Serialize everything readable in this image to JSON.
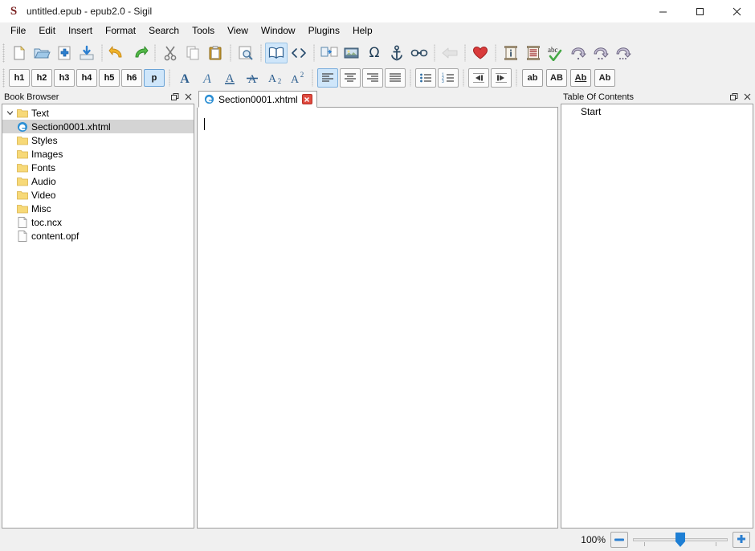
{
  "window": {
    "title": "untitled.epub - epub2.0 - Sigil",
    "logo": "sigil-logo",
    "minimize_label": "–",
    "maximize_label": "☐",
    "close_label": "×"
  },
  "menubar": {
    "items": [
      {
        "label": "File",
        "name": "menu-file"
      },
      {
        "label": "Edit",
        "name": "menu-edit"
      },
      {
        "label": "Insert",
        "name": "menu-insert"
      },
      {
        "label": "Format",
        "name": "menu-format"
      },
      {
        "label": "Search",
        "name": "menu-search"
      },
      {
        "label": "Tools",
        "name": "menu-tools"
      },
      {
        "label": "View",
        "name": "menu-view"
      },
      {
        "label": "Window",
        "name": "menu-window"
      },
      {
        "label": "Plugins",
        "name": "menu-plugins"
      },
      {
        "label": "Help",
        "name": "menu-help"
      }
    ]
  },
  "toolbar_main": {
    "items": [
      {
        "name": "new-file-icon",
        "tooltip": "New"
      },
      {
        "name": "open-file-icon",
        "tooltip": "Open"
      },
      {
        "name": "add-file-icon",
        "tooltip": "Add Existing Files"
      },
      {
        "name": "save-icon",
        "tooltip": "Save"
      },
      {
        "name": "undo-icon",
        "tooltip": "Undo"
      },
      {
        "name": "redo-icon",
        "tooltip": "Redo"
      },
      {
        "name": "cut-icon",
        "tooltip": "Cut"
      },
      {
        "name": "copy-icon",
        "tooltip": "Copy"
      },
      {
        "name": "paste-icon",
        "tooltip": "Paste"
      },
      {
        "name": "find-replace-icon",
        "tooltip": "Find & Replace"
      },
      {
        "name": "book-view-icon",
        "tooltip": "Book View"
      },
      {
        "name": "code-view-icon",
        "tooltip": "Code View"
      },
      {
        "name": "split-at-cursor-icon",
        "tooltip": "Split At Cursor"
      },
      {
        "name": "insert-image-icon",
        "tooltip": "Insert File"
      },
      {
        "name": "special-character-icon",
        "tooltip": "Insert Special Character"
      },
      {
        "name": "insert-id-icon",
        "tooltip": "Insert ID"
      },
      {
        "name": "insert-link-icon",
        "tooltip": "Insert Link"
      },
      {
        "name": "back-icon",
        "tooltip": "Back"
      },
      {
        "name": "heart-icon",
        "tooltip": "Donate"
      },
      {
        "name": "metadata-editor-icon",
        "tooltip": "Metadata Editor"
      },
      {
        "name": "toc-editor-icon",
        "tooltip": "Table Of Contents Editor"
      },
      {
        "name": "spellcheck-icon",
        "tooltip": "Spellcheck"
      },
      {
        "name": "previous-misspelling-icon",
        "tooltip": "Previous Misspelling"
      },
      {
        "name": "next-misspelling-icon",
        "tooltip": "Next Misspelling"
      },
      {
        "name": "add-misspelling-icon",
        "tooltip": "Add Misspelled Word"
      }
    ],
    "book_view_active": true,
    "special_character_glyph": "Ω"
  },
  "toolbar_format": {
    "headings": [
      {
        "label": "h1",
        "active": false
      },
      {
        "label": "h2",
        "active": false
      },
      {
        "label": "h3",
        "active": false
      },
      {
        "label": "h4",
        "active": false
      },
      {
        "label": "h5",
        "active": false
      },
      {
        "label": "h6",
        "active": false
      },
      {
        "label": "p",
        "active": true
      }
    ],
    "styles": [
      {
        "label": "A",
        "name": "bold-icon"
      },
      {
        "label": "A",
        "name": "italic-icon"
      },
      {
        "label": "A",
        "name": "underline-icon"
      },
      {
        "label": "A",
        "name": "strikethrough-icon"
      },
      {
        "label": "A",
        "sub": "2",
        "name": "subscript-icon"
      },
      {
        "label": "A",
        "sup": "2",
        "name": "superscript-icon"
      }
    ],
    "alignment": [
      {
        "name": "align-left-icon",
        "active": true
      },
      {
        "name": "align-center-icon",
        "active": false
      },
      {
        "name": "align-right-icon",
        "active": false
      },
      {
        "name": "align-justify-icon",
        "active": false
      }
    ],
    "lists": [
      {
        "name": "bullet-list-icon"
      },
      {
        "name": "numbered-list-icon"
      }
    ],
    "indent": [
      {
        "name": "decrease-indent-icon"
      },
      {
        "name": "increase-indent-icon"
      }
    ],
    "case_buttons": [
      {
        "label": "ab",
        "name": "lowercase-button"
      },
      {
        "label": "AB",
        "name": "uppercase-button"
      },
      {
        "label": "Ab",
        "name": "titlecase-button"
      },
      {
        "label": "Ab",
        "name": "capitalize-button"
      }
    ]
  },
  "book_browser": {
    "title": "Book Browser",
    "float_label": "❐",
    "close_label": "×",
    "tree": [
      {
        "label": "Text",
        "icon": "folder-icon",
        "expanded": true,
        "level": 0,
        "selected": false
      },
      {
        "label": "Section0001.xhtml",
        "icon": "xhtml-file-icon",
        "level": 1,
        "selected": true
      },
      {
        "label": "Styles",
        "icon": "folder-icon",
        "level": 0,
        "selected": false
      },
      {
        "label": "Images",
        "icon": "folder-icon",
        "level": 0,
        "selected": false
      },
      {
        "label": "Fonts",
        "icon": "folder-icon",
        "level": 0,
        "selected": false
      },
      {
        "label": "Audio",
        "icon": "folder-icon",
        "level": 0,
        "selected": false
      },
      {
        "label": "Video",
        "icon": "folder-icon",
        "level": 0,
        "selected": false
      },
      {
        "label": "Misc",
        "icon": "folder-icon",
        "level": 0,
        "selected": false
      },
      {
        "label": "toc.ncx",
        "icon": "document-icon",
        "level": 0,
        "selected": false
      },
      {
        "label": "content.opf",
        "icon": "document-icon",
        "level": 0,
        "selected": false
      }
    ]
  },
  "editor": {
    "tab": {
      "label": "Section0001.xhtml",
      "icon": "xhtml-file-icon",
      "close_label": "✕"
    },
    "content": ""
  },
  "table_of_contents": {
    "title": "Table Of Contents",
    "float_label": "❐",
    "close_label": "×",
    "entries": [
      {
        "label": "Start"
      }
    ]
  },
  "statusbar": {
    "zoom_label": "100%",
    "zoom_out_label": "–",
    "zoom_in_label": "+",
    "slider_value": 50
  },
  "colors": {
    "accent": "#1e7fd4",
    "active_button": "#cfe6fa",
    "selection": "#d4d4d4",
    "folder": "#f5d678",
    "close_tab": "#e04a3f",
    "panel_bg": "#f0f0f0"
  }
}
